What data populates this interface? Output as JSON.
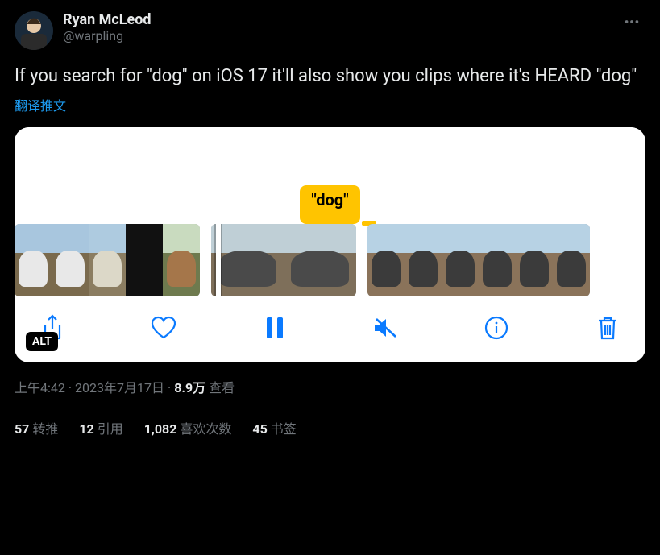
{
  "author": {
    "display_name": "Ryan McLeod",
    "handle": "@warpling"
  },
  "tweet_text": "If you search for \"dog\" on iOS 17 it'll also show you clips where it's HEARD \"dog\"",
  "translate_label": "翻译推文",
  "media": {
    "search_pill": "\"dog\"",
    "alt_badge": "ALT"
  },
  "meta": {
    "time": "上午4:42",
    "date": "2023年7月17日",
    "views_count": "8.9万",
    "views_label": "查看"
  },
  "engagement": {
    "retweets_count": "57",
    "retweets_label": "转推",
    "quotes_count": "12",
    "quotes_label": "引用",
    "likes_count": "1,082",
    "likes_label": "喜欢次数",
    "bookmarks_count": "45",
    "bookmarks_label": "书签"
  }
}
